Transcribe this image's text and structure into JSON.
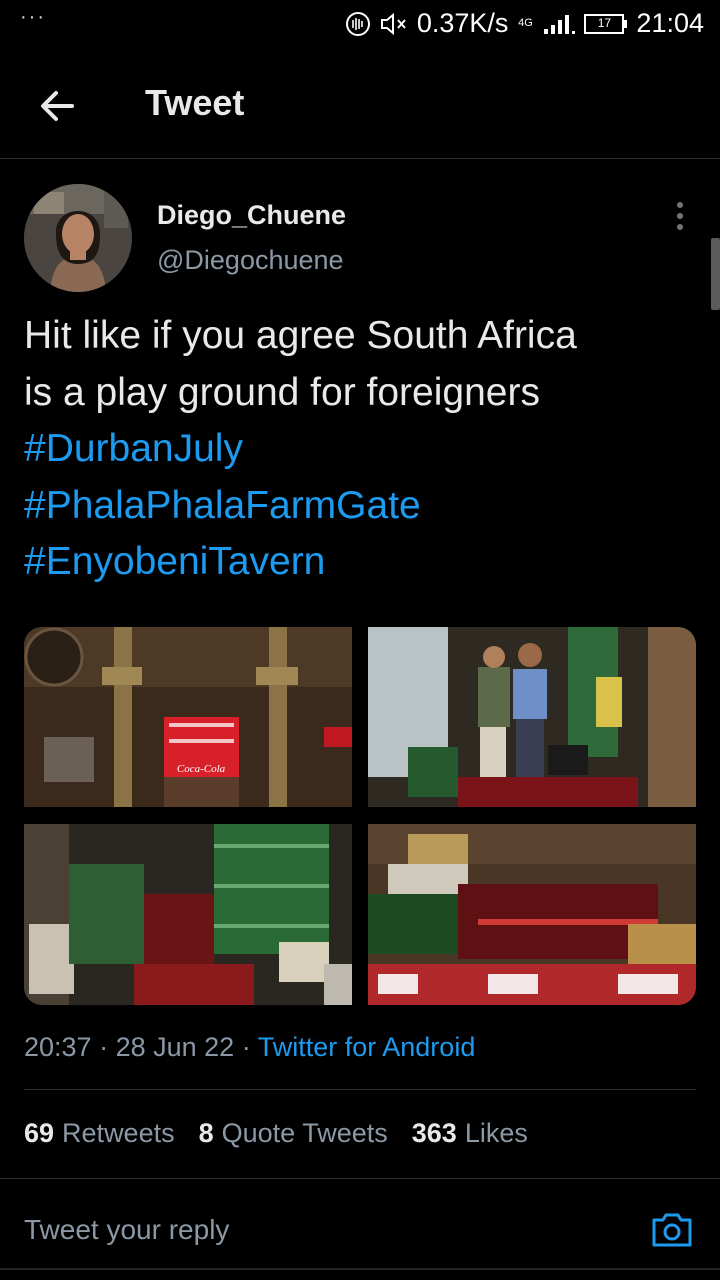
{
  "status_bar": {
    "left_dots": "···",
    "net_speed": "0.37K/s",
    "network": "4G",
    "battery": "17",
    "time": "21:04"
  },
  "header": {
    "title": "Tweet"
  },
  "tweet": {
    "display_name": "Diego_Chuene",
    "handle": "@Diegochuene",
    "text_lines": [
      "Hit like if you agree South Africa",
      "is a play ground for foreigners"
    ],
    "hashtags": [
      "#DurbanJuly",
      "#PhalaPhalaFarmGate",
      "#EnyobeniTavern"
    ],
    "time": "20:37",
    "date": "28 Jun 22",
    "source": "Twitter for Android",
    "crate_text": "Coca-Cola"
  },
  "stats": {
    "retweets_count": "69",
    "retweets_label": "Retweets",
    "quotes_count": "8",
    "quotes_label": "Quote Tweets",
    "likes_count": "363",
    "likes_label": "Likes"
  },
  "reply": {
    "placeholder": "Tweet your reply"
  },
  "colors": {
    "background": "#000000",
    "accent": "#1d9bf0",
    "secondary_text": "#8b98a5",
    "divider": "#2f3336"
  },
  "icons": {
    "back": "arrow-left-icon",
    "more": "more-vertical-icon",
    "camera": "camera-icon"
  }
}
